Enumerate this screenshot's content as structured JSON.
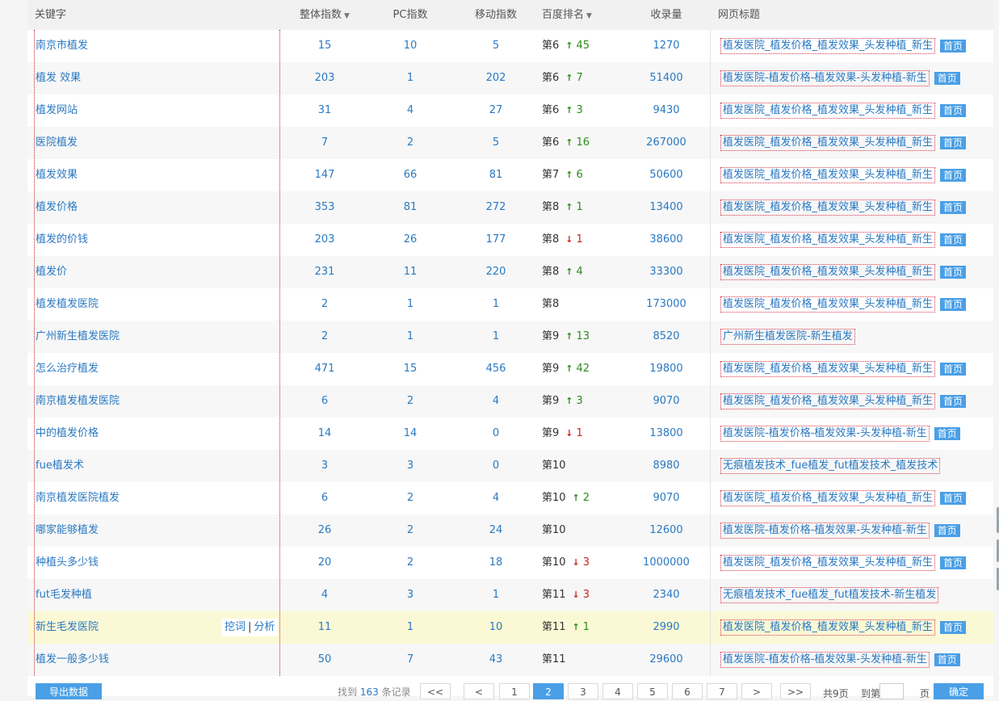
{
  "header": {
    "keyword": "关键字",
    "total_index": "整体指数",
    "pc_index": "PC指数",
    "mobile_index": "移动指数",
    "baidu_rank": "百度排名",
    "indexed": "收录量",
    "page_title": "网页标题"
  },
  "rows": [
    {
      "keyword": "南京市植发",
      "total": "15",
      "pc": "10",
      "mobile": "5",
      "rank": "第6",
      "dir": "up",
      "change": "45",
      "indexed": "1270",
      "title": "植发医院_植发价格_植发效果_头发种植_新生",
      "home": "首页"
    },
    {
      "keyword": "植发 效果",
      "total": "203",
      "pc": "1",
      "mobile": "202",
      "rank": "第6",
      "dir": "up",
      "change": "7",
      "indexed": "51400",
      "title": "植发医院-植发价格-植发效果-头发种植-新生",
      "home": "首页"
    },
    {
      "keyword": "植发网站",
      "total": "31",
      "pc": "4",
      "mobile": "27",
      "rank": "第6",
      "dir": "up",
      "change": "3",
      "indexed": "9430",
      "title": "植发医院_植发价格_植发效果_头发种植_新生",
      "home": "首页"
    },
    {
      "keyword": "医院植发",
      "total": "7",
      "pc": "2",
      "mobile": "5",
      "rank": "第6",
      "dir": "up",
      "change": "16",
      "indexed": "267000",
      "title": "植发医院_植发价格_植发效果_头发种植_新生",
      "home": "首页"
    },
    {
      "keyword": "植发效果",
      "total": "147",
      "pc": "66",
      "mobile": "81",
      "rank": "第7",
      "dir": "up",
      "change": "6",
      "indexed": "50600",
      "title": "植发医院_植发价格_植发效果_头发种植_新生",
      "home": "首页"
    },
    {
      "keyword": "植发价格",
      "total": "353",
      "pc": "81",
      "mobile": "272",
      "rank": "第8",
      "dir": "up",
      "change": "1",
      "indexed": "13400",
      "title": "植发医院_植发价格_植发效果_头发种植_新生",
      "home": "首页"
    },
    {
      "keyword": "植发的价钱",
      "total": "203",
      "pc": "26",
      "mobile": "177",
      "rank": "第8",
      "dir": "down",
      "change": "1",
      "indexed": "38600",
      "title": "植发医院_植发价格_植发效果_头发种植_新生",
      "home": "首页"
    },
    {
      "keyword": "植发价",
      "total": "231",
      "pc": "11",
      "mobile": "220",
      "rank": "第8",
      "dir": "up",
      "change": "4",
      "indexed": "33300",
      "title": "植发医院_植发价格_植发效果_头发种植_新生",
      "home": "首页"
    },
    {
      "keyword": "植发植发医院",
      "total": "2",
      "pc": "1",
      "mobile": "1",
      "rank": "第8",
      "dir": "",
      "change": "",
      "indexed": "173000",
      "title": "植发医院_植发价格_植发效果_头发种植_新生",
      "home": "首页"
    },
    {
      "keyword": "广州新生植发医院",
      "total": "2",
      "pc": "1",
      "mobile": "1",
      "rank": "第9",
      "dir": "up",
      "change": "13",
      "indexed": "8520",
      "title": "广州新生植发医院-新生植发",
      "home": ""
    },
    {
      "keyword": "怎么治疗植发",
      "total": "471",
      "pc": "15",
      "mobile": "456",
      "rank": "第9",
      "dir": "up",
      "change": "42",
      "indexed": "19800",
      "title": "植发医院_植发价格_植发效果_头发种植_新生",
      "home": "首页"
    },
    {
      "keyword": "南京植发植发医院",
      "total": "6",
      "pc": "2",
      "mobile": "4",
      "rank": "第9",
      "dir": "up",
      "change": "3",
      "indexed": "9070",
      "title": "植发医院_植发价格_植发效果_头发种植_新生",
      "home": "首页"
    },
    {
      "keyword": "中的植发价格",
      "total": "14",
      "pc": "14",
      "mobile": "0",
      "rank": "第9",
      "dir": "down",
      "change": "1",
      "indexed": "13800",
      "title": "植发医院-植发价格-植发效果-头发种植-新生",
      "home": "首页"
    },
    {
      "keyword": "fue植发术",
      "total": "3",
      "pc": "3",
      "mobile": "0",
      "rank": "第10",
      "dir": "",
      "change": "",
      "indexed": "8980",
      "title": "无痕植发技术_fue植发_fut植发技术_植发技术",
      "home": ""
    },
    {
      "keyword": "南京植发医院植发",
      "total": "6",
      "pc": "2",
      "mobile": "4",
      "rank": "第10",
      "dir": "up",
      "change": "2",
      "indexed": "9070",
      "title": "植发医院_植发价格_植发效果_头发种植_新生",
      "home": "首页"
    },
    {
      "keyword": "哪家能够植发",
      "total": "26",
      "pc": "2",
      "mobile": "24",
      "rank": "第10",
      "dir": "",
      "change": "",
      "indexed": "12600",
      "title": "植发医院-植发价格-植发效果-头发种植-新生",
      "home": "首页"
    },
    {
      "keyword": "种植头多少钱",
      "total": "20",
      "pc": "2",
      "mobile": "18",
      "rank": "第10",
      "dir": "down",
      "change": "3",
      "indexed": "1000000",
      "title": "植发医院_植发价格_植发效果_头发种植_新生",
      "home": "首页"
    },
    {
      "keyword": "fut毛发种植",
      "total": "4",
      "pc": "3",
      "mobile": "1",
      "rank": "第11",
      "dir": "down",
      "change": "3",
      "indexed": "2340",
      "title": "无痕植发技术_fue植发_fut植发技术-新生植发",
      "home": ""
    },
    {
      "keyword": "新生毛发医院",
      "total": "11",
      "pc": "1",
      "mobile": "10",
      "rank": "第11",
      "dir": "up",
      "change": "1",
      "indexed": "2990",
      "title": "植发医院_植发价格_植发效果_头发种植_新生",
      "home": "首页",
      "actions": {
        "dig": "挖词",
        "sep": "|",
        "analyze": "分析"
      }
    },
    {
      "keyword": "植发一般多少钱",
      "total": "50",
      "pc": "7",
      "mobile": "43",
      "rank": "第11",
      "dir": "",
      "change": "",
      "indexed": "29600",
      "title": "植发医院-植发价格-植发效果-头发种植-新生",
      "home": "首页"
    }
  ],
  "footer": {
    "export": "导出数据",
    "found_prefix": "找到",
    "found_count": "163",
    "found_suffix": "条记录",
    "pager": [
      "<<",
      "<",
      "1",
      "2",
      "3",
      "4",
      "5",
      "6",
      "7",
      ">",
      ">>"
    ],
    "active_page": "2",
    "total_pages": "共9页",
    "goto_prefix": "到第",
    "goto_suffix": "页",
    "ok": "确定"
  },
  "colors": {
    "link_blue": "#2a79c2",
    "rank_up": "#2e8b1e",
    "rank_down": "#c8261d",
    "accent": "#4a9fe6",
    "highlight_row": "#fbf9d5"
  }
}
